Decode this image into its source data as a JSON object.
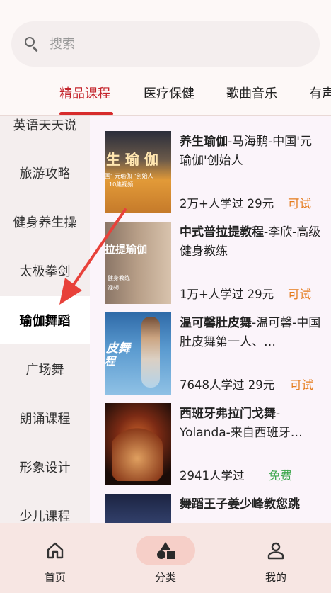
{
  "search": {
    "placeholder": "搜索"
  },
  "tabs": [
    {
      "label": "精品课程",
      "active": true
    },
    {
      "label": "医疗保健",
      "active": false
    },
    {
      "label": "歌曲音乐",
      "active": false
    },
    {
      "label": "有声",
      "active": false
    }
  ],
  "sidebar": {
    "items": [
      {
        "label": "英语天天说"
      },
      {
        "label": "旅游攻略"
      },
      {
        "label": "健身养生操"
      },
      {
        "label": "太极拳剑"
      },
      {
        "label": "瑜伽舞蹈",
        "active": true
      },
      {
        "label": "广场舞"
      },
      {
        "label": "朗诵课程"
      },
      {
        "label": "形象设计"
      },
      {
        "label": "少儿课程"
      }
    ]
  },
  "courses": [
    {
      "title_bold": "养生瑜伽",
      "title_rest": "-马海鹏-中国'元瑜伽'创始人",
      "meta": "2万+人学过 29元",
      "tag": "可试",
      "thumb_text": "生 瑜 伽",
      "thumb_sub": "国\" 元瑜伽 \"创始人",
      "thumb_sub2": "10集视频"
    },
    {
      "title_bold": "中式普拉提教程",
      "title_rest": "-李欣-高级健身教练",
      "meta": "1万+人学过 29元",
      "tag": "可试",
      "thumb_text": "拉提瑜伽",
      "thumb_sub": "健身教练",
      "thumb_sub2": "视频"
    },
    {
      "title_bold": "温可馨肚皮舞",
      "title_rest": "-温可馨-中国肚皮舞第一人、…",
      "meta": "7648人学过 29元",
      "tag": "可试",
      "thumb_text": "皮舞",
      "thumb_sub": "程",
      "thumb_sub2": ""
    },
    {
      "title_bold": "西班牙弗拉门戈舞",
      "title_rest": "-Yolanda-来自西班牙…",
      "meta": "2941人学过",
      "tag": "免费",
      "thumb_text": "",
      "thumb_sub": "",
      "thumb_sub2": ""
    },
    {
      "title_bold": "舞蹈王子姜少峰教您跳",
      "title_rest": "",
      "meta": "",
      "tag": "",
      "thumb_text": "",
      "thumb_sub": "",
      "thumb_sub2": ""
    }
  ],
  "bottom_nav": [
    {
      "label": "首页",
      "icon": "home-icon"
    },
    {
      "label": "分类",
      "icon": "category-icon",
      "active": true
    },
    {
      "label": "我的",
      "icon": "person-icon"
    }
  ],
  "colors": {
    "accent": "#c4242b",
    "try": "#e47b1c",
    "free": "#3aa64a",
    "arrow": "#e8413a"
  }
}
